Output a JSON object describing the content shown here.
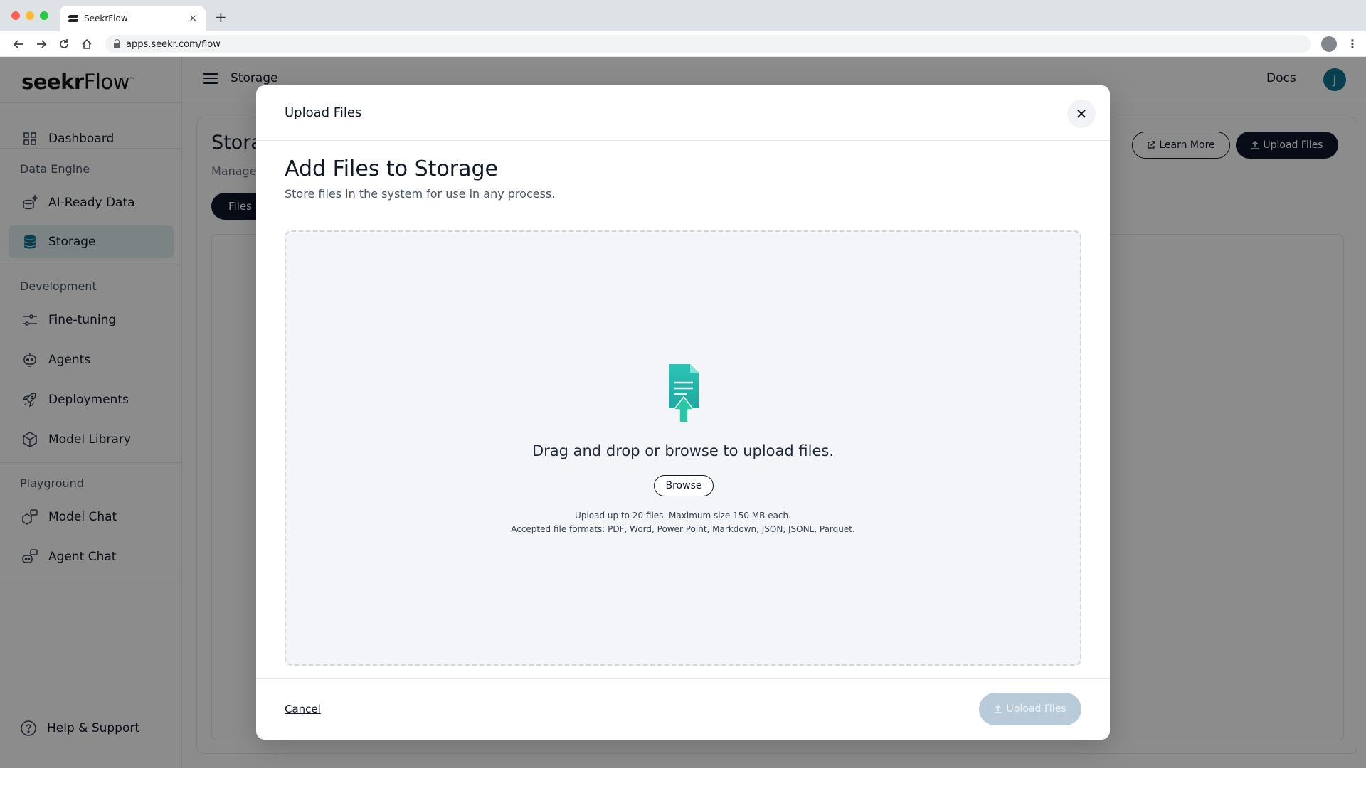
{
  "browser": {
    "tab_title": "SeekrFlow",
    "tab_close": "×",
    "new_tab": "+",
    "url": "apps.seekr.com/flow"
  },
  "sidebar": {
    "logo_bold": "seekr",
    "logo_light": "Flow",
    "logo_mark": "™",
    "dashboard": "Dashboard",
    "sections": [
      {
        "label": "Data Engine"
      },
      {
        "label": "Development"
      },
      {
        "label": "Playground"
      }
    ],
    "items": [
      {
        "label": "AI-Ready Data",
        "icon": "sparkle-data-icon"
      },
      {
        "label": "Storage",
        "icon": "database-icon",
        "active": true
      },
      {
        "label": "Fine-tuning",
        "icon": "sliders-icon"
      },
      {
        "label": "Agents",
        "icon": "robot-icon"
      },
      {
        "label": "Deployments",
        "icon": "rocket-icon"
      },
      {
        "label": "Model Library",
        "icon": "cube-icon"
      },
      {
        "label": "Model Chat",
        "icon": "model-chat-icon"
      },
      {
        "label": "Agent Chat",
        "icon": "agent-chat-icon"
      }
    ],
    "help": "Help & Support"
  },
  "topbar": {
    "breadcrumb": "Storage",
    "docs": "Docs",
    "avatar_initial": "J"
  },
  "page": {
    "title": "Stora",
    "subtitle": "Manage",
    "files_tab": "Files",
    "learn_more": "Learn More",
    "upload_files": "Upload Files"
  },
  "modal": {
    "title": "Upload Files",
    "close": "✕",
    "heading": "Add Files to Storage",
    "description": "Store files in the system for use in any process.",
    "drop_text": "Drag and drop or browse to upload files.",
    "browse": "Browse",
    "note_limit": "Upload up to 20 files. Maximum size 150 MB each.",
    "note_formats": "Accepted file formats: PDF, Word, Power Point, Markdown, JSON, JSONL, Parquet.",
    "cancel": "Cancel",
    "upload_button": "Upload Files"
  },
  "colors": {
    "accent": "#0e7490",
    "dark": "#0f172a",
    "icon_teal": "#2cc4b4",
    "active_bg": "#e0eef2"
  }
}
